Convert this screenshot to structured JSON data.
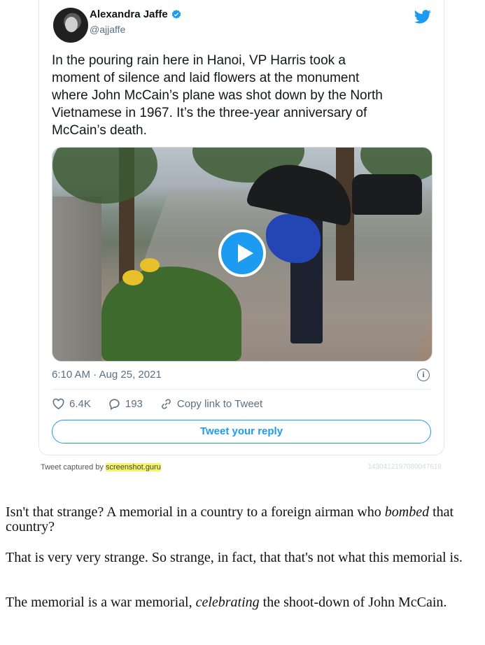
{
  "tweet": {
    "author_name": "Alexandra Jaffe",
    "author_handle": "@ajjaffe",
    "text": "In the pouring rain here in Hanoi, VP Harris took a\nmoment of silence and laid flowers at the monument\nwhere John McCain’s plane was shot down by the North\nVietnamese in 1967. It’s the three-year anniversary of\nMcCain’s death.",
    "timestamp": "6:10 AM · Aug 25, 2021",
    "likes": "6.4K",
    "replies": "193",
    "copy_link_label": "Copy link to Tweet",
    "reply_button_label": "Tweet your reply",
    "icons": [
      "verified-badge-icon",
      "twitter-bird-icon",
      "play-icon",
      "info-icon",
      "heart-icon",
      "reply-bubble-icon",
      "link-icon"
    ],
    "accent_color": "#1d9bf0"
  },
  "capture": {
    "prefix": "Tweet captured by ",
    "site": "screenshot.guru",
    "id": "1430412197080047618"
  },
  "article": {
    "p1_a": "Isn't that strange? A memorial in a country to a foreign airman who ",
    "p1_em": "bombed",
    "p1_b": " that country?",
    "p2": "That is very very strange. So strange, in fact, that that's not what this memorial is.",
    "p3_a": "The memorial is a war memorial, ",
    "p3_em": "celebrating",
    "p3_b": " the shoot-down of John McCain."
  }
}
